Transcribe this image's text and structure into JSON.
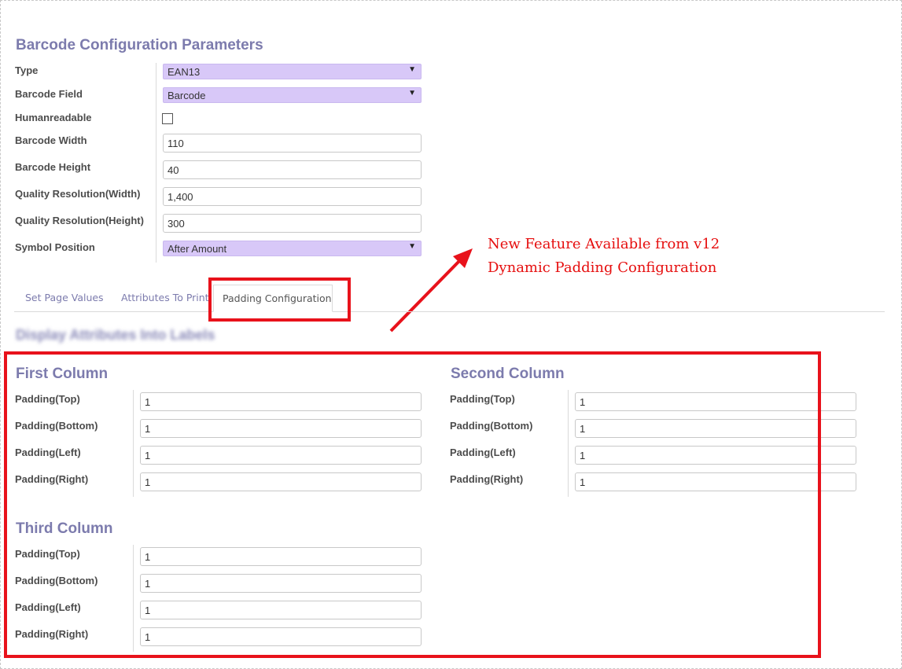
{
  "title": "Barcode Configuration Parameters",
  "fields": {
    "type": {
      "label": "Type",
      "value": "EAN13"
    },
    "barcode_field": {
      "label": "Barcode Field",
      "value": "Barcode"
    },
    "humanreadable": {
      "label": "Humanreadable",
      "checked": false
    },
    "barcode_width": {
      "label": "Barcode Width",
      "value": "110"
    },
    "barcode_height": {
      "label": "Barcode Height",
      "value": "40"
    },
    "quality_width": {
      "label": "Quality Resolution(Width)",
      "value": "1,400"
    },
    "quality_height": {
      "label": "Quality Resolution(Height)",
      "value": "300"
    },
    "symbol_position": {
      "label": "Symbol Position",
      "value": "After Amount"
    }
  },
  "annotation": {
    "line1": "New Feature Available from v12",
    "line2": "Dynamic Padding Configuration",
    "color": "#e60f0f"
  },
  "tabs": [
    {
      "label": "Set Page Values",
      "active": false
    },
    {
      "label": "Attributes To Print",
      "active": false
    },
    {
      "label": "Padding Configuration",
      "active": true
    }
  ],
  "blurred_heading": "Display Attributes Into Labels",
  "padding_labels": {
    "top": "Padding(Top)",
    "bottom": "Padding(Bottom)",
    "left": "Padding(Left)",
    "right": "Padding(Right)"
  },
  "columns": [
    {
      "title": "First Column",
      "top": "1",
      "bottom": "1",
      "left": "1",
      "right": "1"
    },
    {
      "title": "Second Column",
      "top": "1",
      "bottom": "1",
      "left": "1",
      "right": "1"
    },
    {
      "title": "Third Column",
      "top": "1",
      "bottom": "1",
      "left": "1",
      "right": "1"
    }
  ],
  "colors": {
    "accent": "#7c7bad",
    "select_bg": "#d8c8f8",
    "highlight": "#e8121b"
  }
}
